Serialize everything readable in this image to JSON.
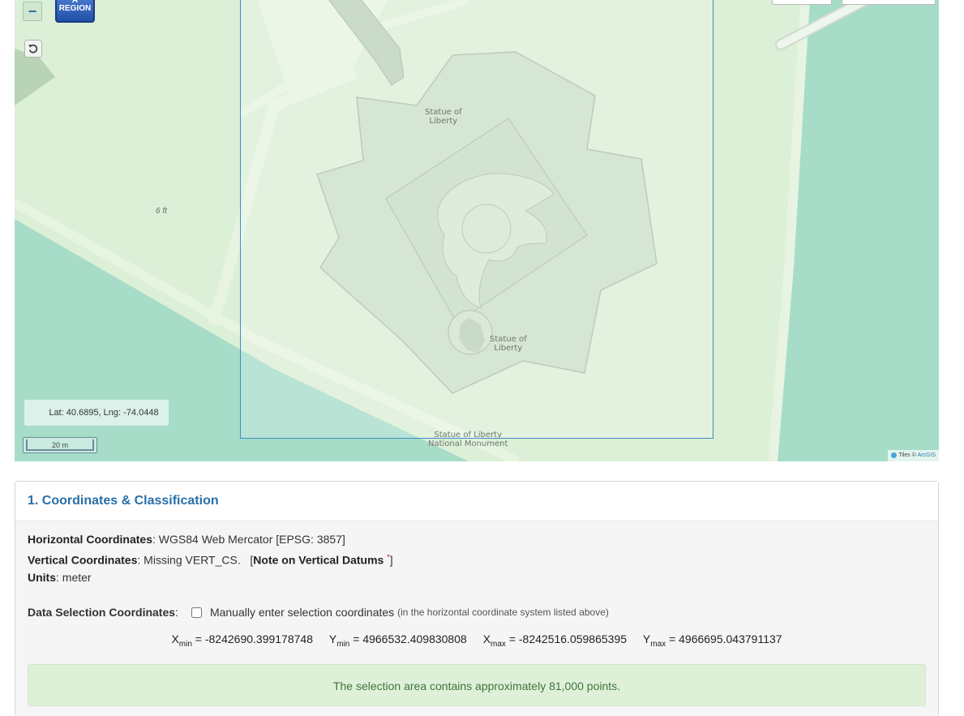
{
  "map": {
    "labels": {
      "statue_top": [
        "Statue of",
        "Liberty"
      ],
      "statue_right": [
        "Statue of",
        "Liberty"
      ],
      "monument": [
        "Statue of Liberty",
        "National Monument"
      ],
      "elevation": "6 ft"
    },
    "controls": {
      "zoom_out": "−",
      "region_button": [
        "A",
        "REGION"
      ],
      "reset_icon": "rotate-ccw-icon"
    },
    "coordinate_readout": "Lat: 40.6895, Lng: -74.0448",
    "scale_bar": "20 m",
    "attribution": {
      "prefix": "Tiles ©",
      "link": "ArcGIS"
    },
    "colors": {
      "land": "#dcefd7",
      "water": "#a6dcc8",
      "path": "#e6f4e1",
      "selection_border": "#3b8dc7"
    }
  },
  "panel": {
    "title": "1. Coordinates & Classification",
    "horizontal": {
      "label": "Horizontal Coordinates",
      "value": ": WGS84 Web Mercator [EPSG: 3857]"
    },
    "vertical": {
      "label": "Vertical Coordinates",
      "value": ": Missing VERT_CS.",
      "note_link": "Note on Vertical Datums",
      "asterisk": "*"
    },
    "units": {
      "label": "Units",
      "value": ": meter"
    },
    "selection": {
      "label": "Data Selection Coordinates",
      "checkbox_label": "Manually enter selection coordinates",
      "note": "(in the horizontal coordinate system listed above)"
    },
    "coords": {
      "xmin": {
        "label": "X",
        "sub": "min",
        "value": "= -8242690.399178748"
      },
      "ymin": {
        "label": "Y",
        "sub": "min",
        "value": "= 4966532.409830808"
      },
      "xmax": {
        "label": "X",
        "sub": "max",
        "value": "= -8242516.059865395"
      },
      "ymax": {
        "label": "Y",
        "sub": "max",
        "value": "= 4966695.043791137"
      }
    },
    "alert": "The selection area contains approximately 81,000 points."
  }
}
